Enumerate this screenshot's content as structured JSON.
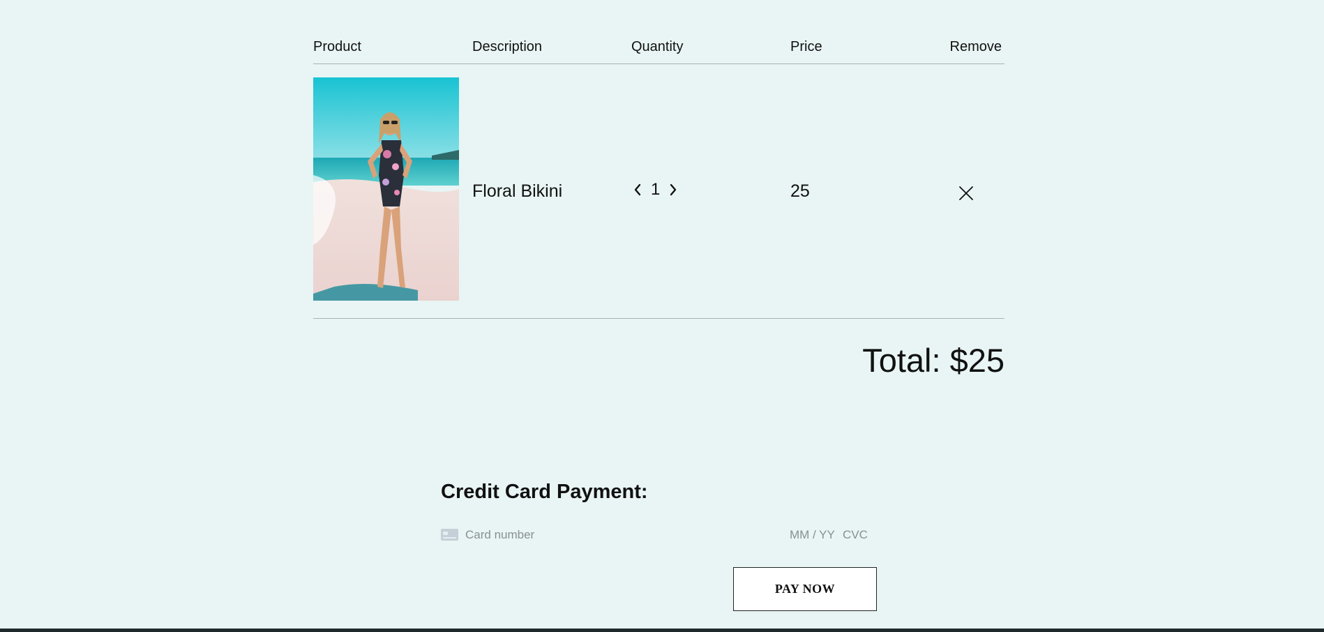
{
  "cart": {
    "headers": {
      "product": "Product",
      "description": "Description",
      "quantity": "Quantity",
      "price": "Price",
      "remove": "Remove"
    },
    "items": [
      {
        "image_icon": "swimsuit-photo",
        "description": "Floral Bikini",
        "quantity": "1",
        "price": "25",
        "remove_icon": "close-icon"
      }
    ],
    "total": "Total: $25"
  },
  "payment": {
    "title": "Credit Card Payment:",
    "card_number_placeholder": "Card number",
    "expiry_placeholder": "MM / YY",
    "cvc_placeholder": "CVC",
    "pay_button_label": "PAY NOW"
  },
  "icons": {
    "decrement": "chevron-left-icon",
    "increment": "chevron-right-icon",
    "card": "credit-card-icon"
  },
  "colors": {
    "background": "#e8f5f4",
    "divider": "#a9b2b2",
    "footer": "#1f2a2c"
  }
}
